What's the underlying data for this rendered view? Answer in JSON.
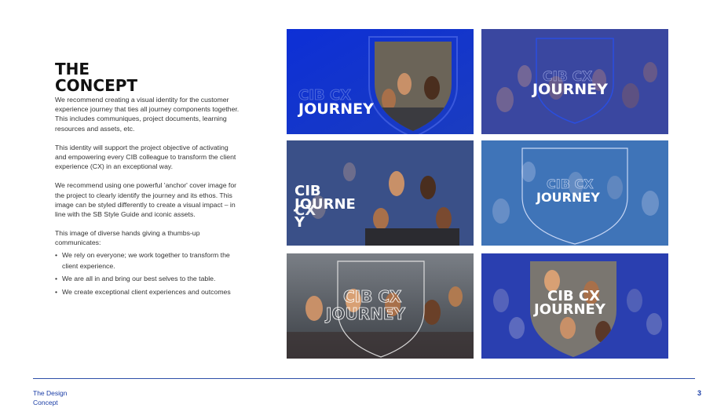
{
  "slide": {
    "title": "THE\nCONCEPT",
    "paragraphs": [
      "We recommend creating a visual identity for the customer experience journey that ties all journey components together. This includes communiques, project documents, learning resources and assets, etc.",
      "This identity will support the project objective of activating and empowering every CIB colleague to transform the client experience (CX) in an exceptional way.",
      "We recommend using one powerful 'anchor' cover image for the project to clearly identify the journey and its ethos. This image can be styled differently to create a visual impact – in line with the SB Style Guide and iconic assets.",
      "This image of diverse hands giving a thumbs-up communicates:"
    ],
    "bullets": [
      "We rely on everyone; we work together to transform the client experience.",
      "We are all in and bring our best selves to the table.",
      "We create exceptional client experiences and outcomes"
    ]
  },
  "tiles": [
    {
      "line1": "CIB CX",
      "line2": "JOURNEY",
      "bg": "#1436c8"
    },
    {
      "line1": "CIB CX",
      "line2": "JOURNEY",
      "bg": "#3a47a0"
    },
    {
      "line1": "CIB",
      "line2": "JOURNE",
      "line3": "CX",
      "line4": "Y",
      "bg": "#3a5088"
    },
    {
      "line1": "CIB CX",
      "line2": "JOURNEY",
      "bg": "#3f74b8"
    },
    {
      "line1": "CIB CX",
      "line2": "JOURNEY",
      "bg": "#4a5666"
    },
    {
      "line1": "CIB CX",
      "line2": "JOURNEY",
      "bg": "#2a3fb0"
    }
  ],
  "footer": {
    "label": "The Design\nConcept",
    "page": "3"
  },
  "colors": {
    "accent": "#1a3da6",
    "tile_text": "#ffffff"
  }
}
